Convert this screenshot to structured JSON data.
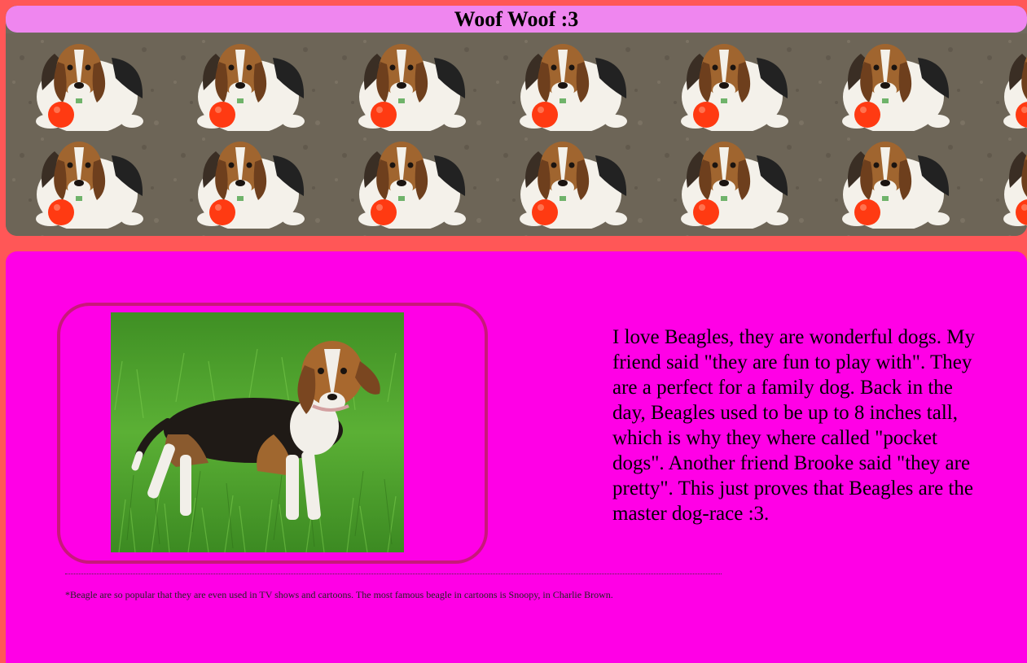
{
  "header": {
    "title": "Woof Woof :3",
    "background_image": "beagle-with-red-ball-tile"
  },
  "main": {
    "photo": "beagle-standing-in-grass-photo",
    "description": "I love Beagles, they are wonderful dogs. My friend said \"they are fun to play with\". They are a perfect for a family dog. Back in the day, Beagles used to be up to 8 inches tall, which is why they where called \"pocket dogs\". Another friend Brooke said \"they are pretty\". This just proves that Beagles are the master dog-race :3.",
    "footnote": "*Beagle are so popular that they are even used in TV shows and cartoons. The most famous beagle in cartoons is Snoopy, in Charlie Brown."
  },
  "colors": {
    "page_background": "#ff5757",
    "title_bar": "#ef86ef",
    "main_background": "#ff00e6",
    "photo_frame_border": "#c8187a"
  }
}
